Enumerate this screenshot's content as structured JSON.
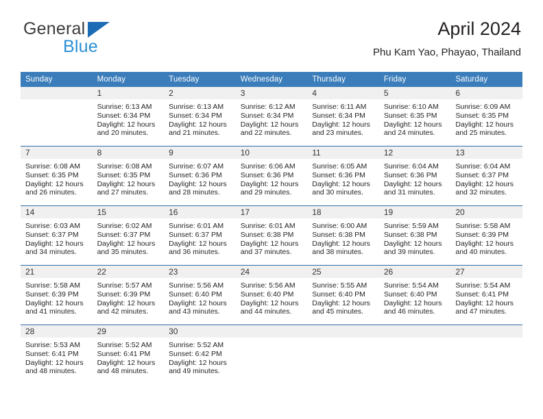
{
  "brand": {
    "name_part1": "General",
    "name_part2": "Blue",
    "triangle_color": "#1b6cb5",
    "blue_color": "#2a8fd4"
  },
  "header": {
    "title": "April 2024",
    "subtitle": "Phu Kam Yao, Phayao, Thailand"
  },
  "theme": {
    "header_bg": "#3a7dba",
    "row_divider": "#2f6ea8",
    "daynum_bg": "#f0f0f0",
    "text": "#231f20"
  },
  "calendar": {
    "weekday_headers": [
      "Sunday",
      "Monday",
      "Tuesday",
      "Wednesday",
      "Thursday",
      "Friday",
      "Saturday"
    ],
    "weeks": [
      [
        {
          "day": "",
          "sunrise": "",
          "sunset": "",
          "daylight1": "",
          "daylight2": ""
        },
        {
          "day": "1",
          "sunrise": "Sunrise: 6:13 AM",
          "sunset": "Sunset: 6:34 PM",
          "daylight1": "Daylight: 12 hours",
          "daylight2": "and 20 minutes."
        },
        {
          "day": "2",
          "sunrise": "Sunrise: 6:13 AM",
          "sunset": "Sunset: 6:34 PM",
          "daylight1": "Daylight: 12 hours",
          "daylight2": "and 21 minutes."
        },
        {
          "day": "3",
          "sunrise": "Sunrise: 6:12 AM",
          "sunset": "Sunset: 6:34 PM",
          "daylight1": "Daylight: 12 hours",
          "daylight2": "and 22 minutes."
        },
        {
          "day": "4",
          "sunrise": "Sunrise: 6:11 AM",
          "sunset": "Sunset: 6:34 PM",
          "daylight1": "Daylight: 12 hours",
          "daylight2": "and 23 minutes."
        },
        {
          "day": "5",
          "sunrise": "Sunrise: 6:10 AM",
          "sunset": "Sunset: 6:35 PM",
          "daylight1": "Daylight: 12 hours",
          "daylight2": "and 24 minutes."
        },
        {
          "day": "6",
          "sunrise": "Sunrise: 6:09 AM",
          "sunset": "Sunset: 6:35 PM",
          "daylight1": "Daylight: 12 hours",
          "daylight2": "and 25 minutes."
        }
      ],
      [
        {
          "day": "7",
          "sunrise": "Sunrise: 6:08 AM",
          "sunset": "Sunset: 6:35 PM",
          "daylight1": "Daylight: 12 hours",
          "daylight2": "and 26 minutes."
        },
        {
          "day": "8",
          "sunrise": "Sunrise: 6:08 AM",
          "sunset": "Sunset: 6:35 PM",
          "daylight1": "Daylight: 12 hours",
          "daylight2": "and 27 minutes."
        },
        {
          "day": "9",
          "sunrise": "Sunrise: 6:07 AM",
          "sunset": "Sunset: 6:36 PM",
          "daylight1": "Daylight: 12 hours",
          "daylight2": "and 28 minutes."
        },
        {
          "day": "10",
          "sunrise": "Sunrise: 6:06 AM",
          "sunset": "Sunset: 6:36 PM",
          "daylight1": "Daylight: 12 hours",
          "daylight2": "and 29 minutes."
        },
        {
          "day": "11",
          "sunrise": "Sunrise: 6:05 AM",
          "sunset": "Sunset: 6:36 PM",
          "daylight1": "Daylight: 12 hours",
          "daylight2": "and 30 minutes."
        },
        {
          "day": "12",
          "sunrise": "Sunrise: 6:04 AM",
          "sunset": "Sunset: 6:36 PM",
          "daylight1": "Daylight: 12 hours",
          "daylight2": "and 31 minutes."
        },
        {
          "day": "13",
          "sunrise": "Sunrise: 6:04 AM",
          "sunset": "Sunset: 6:37 PM",
          "daylight1": "Daylight: 12 hours",
          "daylight2": "and 32 minutes."
        }
      ],
      [
        {
          "day": "14",
          "sunrise": "Sunrise: 6:03 AM",
          "sunset": "Sunset: 6:37 PM",
          "daylight1": "Daylight: 12 hours",
          "daylight2": "and 34 minutes."
        },
        {
          "day": "15",
          "sunrise": "Sunrise: 6:02 AM",
          "sunset": "Sunset: 6:37 PM",
          "daylight1": "Daylight: 12 hours",
          "daylight2": "and 35 minutes."
        },
        {
          "day": "16",
          "sunrise": "Sunrise: 6:01 AM",
          "sunset": "Sunset: 6:37 PM",
          "daylight1": "Daylight: 12 hours",
          "daylight2": "and 36 minutes."
        },
        {
          "day": "17",
          "sunrise": "Sunrise: 6:01 AM",
          "sunset": "Sunset: 6:38 PM",
          "daylight1": "Daylight: 12 hours",
          "daylight2": "and 37 minutes."
        },
        {
          "day": "18",
          "sunrise": "Sunrise: 6:00 AM",
          "sunset": "Sunset: 6:38 PM",
          "daylight1": "Daylight: 12 hours",
          "daylight2": "and 38 minutes."
        },
        {
          "day": "19",
          "sunrise": "Sunrise: 5:59 AM",
          "sunset": "Sunset: 6:38 PM",
          "daylight1": "Daylight: 12 hours",
          "daylight2": "and 39 minutes."
        },
        {
          "day": "20",
          "sunrise": "Sunrise: 5:58 AM",
          "sunset": "Sunset: 6:39 PM",
          "daylight1": "Daylight: 12 hours",
          "daylight2": "and 40 minutes."
        }
      ],
      [
        {
          "day": "21",
          "sunrise": "Sunrise: 5:58 AM",
          "sunset": "Sunset: 6:39 PM",
          "daylight1": "Daylight: 12 hours",
          "daylight2": "and 41 minutes."
        },
        {
          "day": "22",
          "sunrise": "Sunrise: 5:57 AM",
          "sunset": "Sunset: 6:39 PM",
          "daylight1": "Daylight: 12 hours",
          "daylight2": "and 42 minutes."
        },
        {
          "day": "23",
          "sunrise": "Sunrise: 5:56 AM",
          "sunset": "Sunset: 6:40 PM",
          "daylight1": "Daylight: 12 hours",
          "daylight2": "and 43 minutes."
        },
        {
          "day": "24",
          "sunrise": "Sunrise: 5:56 AM",
          "sunset": "Sunset: 6:40 PM",
          "daylight1": "Daylight: 12 hours",
          "daylight2": "and 44 minutes."
        },
        {
          "day": "25",
          "sunrise": "Sunrise: 5:55 AM",
          "sunset": "Sunset: 6:40 PM",
          "daylight1": "Daylight: 12 hours",
          "daylight2": "and 45 minutes."
        },
        {
          "day": "26",
          "sunrise": "Sunrise: 5:54 AM",
          "sunset": "Sunset: 6:40 PM",
          "daylight1": "Daylight: 12 hours",
          "daylight2": "and 46 minutes."
        },
        {
          "day": "27",
          "sunrise": "Sunrise: 5:54 AM",
          "sunset": "Sunset: 6:41 PM",
          "daylight1": "Daylight: 12 hours",
          "daylight2": "and 47 minutes."
        }
      ],
      [
        {
          "day": "28",
          "sunrise": "Sunrise: 5:53 AM",
          "sunset": "Sunset: 6:41 PM",
          "daylight1": "Daylight: 12 hours",
          "daylight2": "and 48 minutes."
        },
        {
          "day": "29",
          "sunrise": "Sunrise: 5:52 AM",
          "sunset": "Sunset: 6:41 PM",
          "daylight1": "Daylight: 12 hours",
          "daylight2": "and 48 minutes."
        },
        {
          "day": "30",
          "sunrise": "Sunrise: 5:52 AM",
          "sunset": "Sunset: 6:42 PM",
          "daylight1": "Daylight: 12 hours",
          "daylight2": "and 49 minutes."
        },
        {
          "day": "",
          "sunrise": "",
          "sunset": "",
          "daylight1": "",
          "daylight2": ""
        },
        {
          "day": "",
          "sunrise": "",
          "sunset": "",
          "daylight1": "",
          "daylight2": ""
        },
        {
          "day": "",
          "sunrise": "",
          "sunset": "",
          "daylight1": "",
          "daylight2": ""
        },
        {
          "day": "",
          "sunrise": "",
          "sunset": "",
          "daylight1": "",
          "daylight2": ""
        }
      ]
    ]
  }
}
